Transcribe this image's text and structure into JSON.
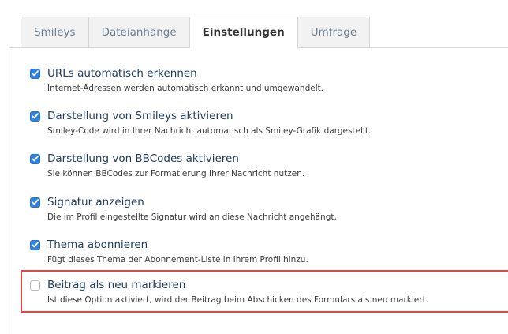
{
  "tabs": [
    {
      "label": "Smileys",
      "active": false
    },
    {
      "label": "Dateianhänge",
      "active": false
    },
    {
      "label": "Einstellungen",
      "active": true
    },
    {
      "label": "Umfrage",
      "active": false
    }
  ],
  "options": [
    {
      "title": "URLs automatisch erkennen",
      "description": "Internet-Adressen werden automatisch erkannt und umgewandelt.",
      "checked": true
    },
    {
      "title": "Darstellung von Smileys aktivieren",
      "description": "Smiley-Code wird in Ihrer Nachricht automatisch als Smiley-Grafik dargestellt.",
      "checked": true
    },
    {
      "title": "Darstellung von BBCodes aktivieren",
      "description": "Sie können BBCodes zur Formatierung Ihrer Nachricht nutzen.",
      "checked": true
    },
    {
      "title": "Signatur anzeigen",
      "description": "Die im Profil eingestellte Signatur wird an diese Nachricht angehängt.",
      "checked": true
    },
    {
      "title": "Thema abonnieren",
      "description": "Fügt dieses Thema der Abonnement-Liste in Ihrem Profil hinzu.",
      "checked": true
    },
    {
      "title": "Beitrag als neu markieren",
      "description": "Ist diese Option aktiviert, wird der Beitrag beim Abschicken des Formulars als neu markiert.",
      "checked": false,
      "highlighted": true
    }
  ],
  "colors": {
    "checkbox_checked": "#2f82de",
    "highlight_border": "#e1454c",
    "option_title": "#1f3e63",
    "tab_text": "#6a7f93"
  }
}
